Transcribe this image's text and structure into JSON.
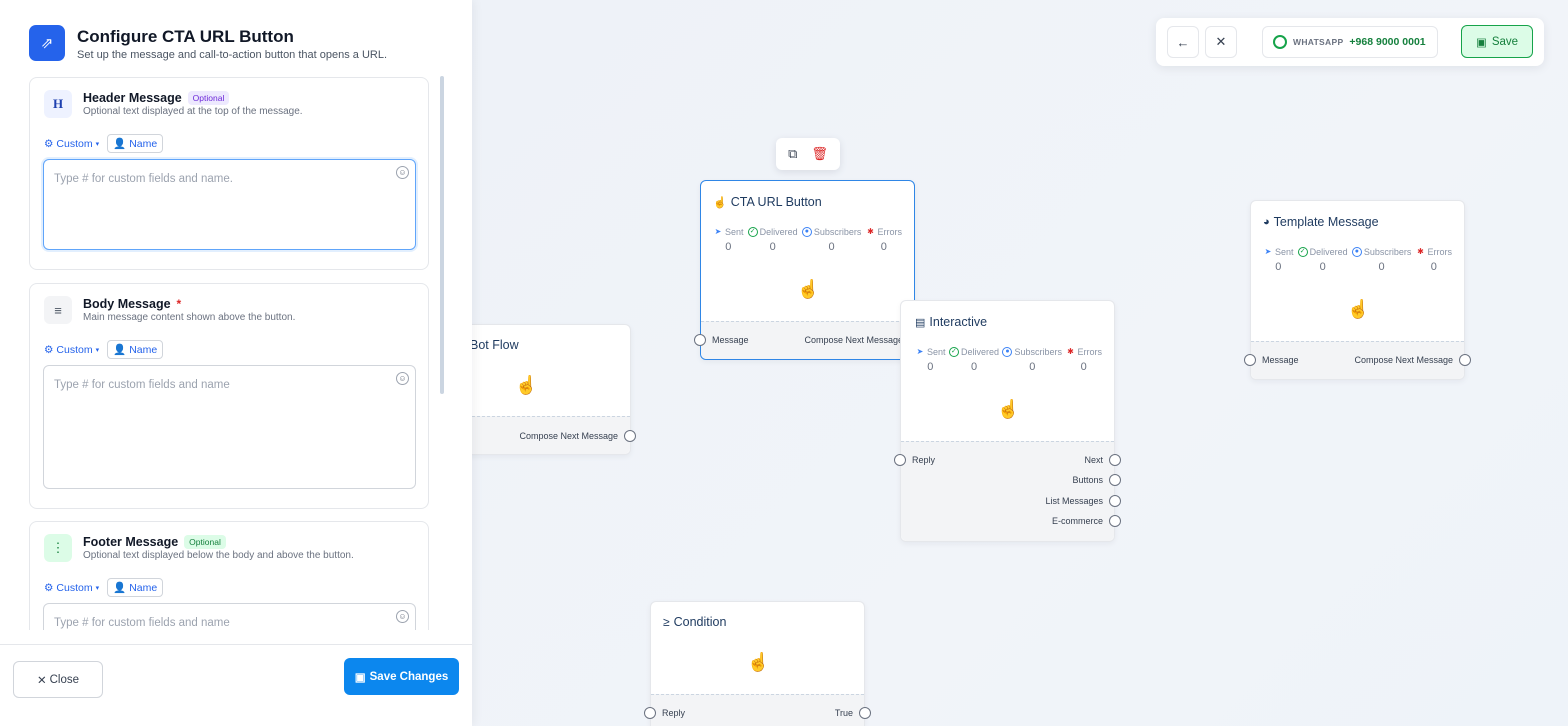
{
  "panel": {
    "title": "Configure CTA URL Button",
    "subtitle": "Set up the message and call-to-action button that opens a URL.",
    "sections": [
      {
        "title": "Header Message",
        "badge": "Optional",
        "description": "Optional text displayed at the top of the message.",
        "custom_label": "Custom",
        "name_label": "Name",
        "placeholder": "Type # for custom fields and name."
      },
      {
        "title": "Body Message",
        "required_mark": "*",
        "description": "Main message content shown above the button.",
        "custom_label": "Custom",
        "name_label": "Name",
        "placeholder": "Type # for custom fields and name"
      },
      {
        "title": "Footer Message",
        "badge": "Optional",
        "description": "Optional text displayed below the body and above the button.",
        "custom_label": "Custom",
        "name_label": "Name",
        "placeholder": "Type # for custom fields and name"
      }
    ],
    "close_label": "Close",
    "save_label": "Save Changes"
  },
  "topbar": {
    "channel_label": "WHATSAPP",
    "phone": "+968 9000 0001",
    "save_label": "Save"
  },
  "stat_labels": {
    "sent": "Sent",
    "delivered": "Delivered",
    "subscribers": "Subscribers",
    "errors": "Errors"
  },
  "nodes": {
    "cta": {
      "title": "CTA URL Button",
      "sent": "0",
      "delivered": "0",
      "subscribers": "0",
      "errors": "0",
      "in_port": "Message",
      "out_port": "Compose Next Message"
    },
    "template": {
      "title": "Template Message",
      "sent": "0",
      "delivered": "0",
      "subscribers": "0",
      "errors": "0",
      "in_port": "Message",
      "out_port": "Compose Next Message"
    },
    "interactive": {
      "title": "Interactive",
      "sent": "0",
      "delivered": "0",
      "subscribers": "0",
      "errors": "0",
      "in_port": "Reply",
      "out_ports": [
        "Next",
        "Buttons",
        "List Messages",
        "E-commerce"
      ]
    },
    "botflow": {
      "title": "Bot Flow",
      "out_port": "Compose Next Message"
    },
    "condition": {
      "title": "Condition",
      "in_port": "Reply",
      "out_port": "True"
    }
  },
  "colors": {
    "accent": "#2563eb",
    "save_button": "#0c87ee",
    "whatsapp_green": "#16a34a",
    "error_red": "#dc2626",
    "selected_border": "#2f86e6"
  }
}
